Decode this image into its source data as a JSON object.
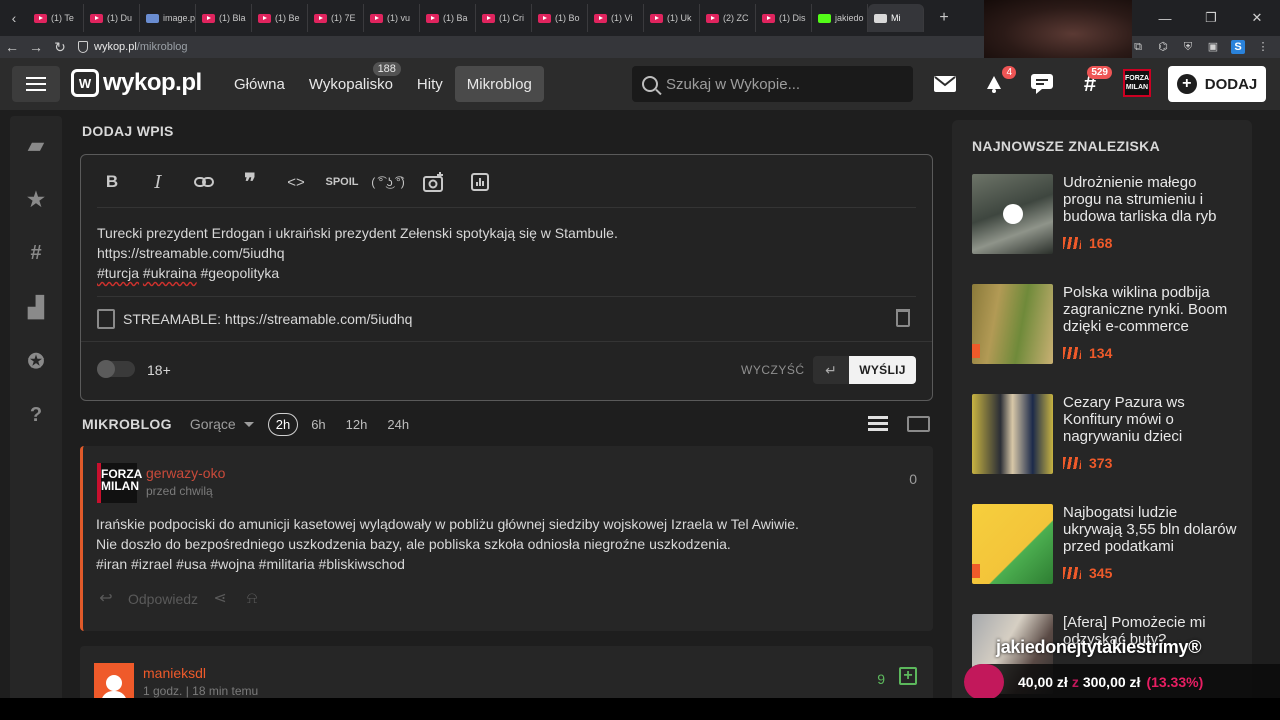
{
  "browser": {
    "tabs": [
      {
        "label": "(1) Te",
        "fav": "youtube"
      },
      {
        "label": "(1) Du",
        "fav": "youtube"
      },
      {
        "label": "image.png",
        "fav": "image"
      },
      {
        "label": "(1) Bla",
        "fav": "youtube"
      },
      {
        "label": "(1) Be",
        "fav": "youtube"
      },
      {
        "label": "(1) 7E",
        "fav": "youtube"
      },
      {
        "label": "(1) vu",
        "fav": "youtube"
      },
      {
        "label": "(1) Ba",
        "fav": "youtube"
      },
      {
        "label": "(1) Cri",
        "fav": "youtube"
      },
      {
        "label": "(1) Bo",
        "fav": "youtube"
      },
      {
        "label": "(1) Vi",
        "fav": "youtube"
      },
      {
        "label": "(1) Uk",
        "fav": "youtube"
      },
      {
        "label": "(2) ZC",
        "fav": "youtube"
      },
      {
        "label": "(1) Dis",
        "fav": "youtube"
      },
      {
        "label": "jakiedo",
        "fav": "kick"
      },
      {
        "label": "Mi",
        "fav": "wykop",
        "active": true
      }
    ],
    "url_host": "wykop.pl",
    "url_path": "/mikroblog"
  },
  "nav": {
    "logo": "wykop.pl",
    "links": [
      {
        "label": "Główna"
      },
      {
        "label": "Wykopalisko",
        "badge": "188"
      },
      {
        "label": "Hity"
      },
      {
        "label": "Mikroblog",
        "active": true
      }
    ],
    "search_placeholder": "Szukaj w Wykopie...",
    "notifications_count": "4",
    "tags_count": "529",
    "avatar_text": "FORZA MILAN",
    "add_label": "DODAJ"
  },
  "compose": {
    "title": "DODAJ WPIS",
    "toolbar": [
      "B",
      "I",
      "link",
      "quote",
      "code",
      "SPOIL",
      "( ͡° ͜ʖ ͡°)",
      "photo",
      "poll"
    ],
    "lines": [
      "Turecki prezydent Erdogan i ukraiński prezydent Zełenski spotykają się w Stambule.",
      "https://streamable.com/5iudhq"
    ],
    "tags_line": {
      "t1": "#turcja",
      "t2": "#ukraina",
      "t3": "#geopolityka"
    },
    "embed_label": "STREAMABLE: https://streamable.com/5iudhq",
    "adult_label": "18+",
    "clear_label": "WYCZYŚĆ",
    "send_label": "WYŚLIJ"
  },
  "feed": {
    "title": "MIKROBLOG",
    "sort": "Gorące",
    "periods": [
      "2h",
      "6h",
      "12h",
      "24h"
    ],
    "active_period": "2h"
  },
  "posts": [
    {
      "author": "gerwazy-oko",
      "time": "przed chwilą",
      "score": "0",
      "avatar_lines": [
        "FORZA",
        "MILAN"
      ],
      "lines": [
        "Irańskie podpociski do amunicji kasetowej wylądowały w pobliżu głównej siedziby wojskowej Izraela w Tel Awiwie.",
        "Nie doszło do bezpośredniego uszkodzenia bazy, ale pobliska szkoła odniosła niegroźne uszkodzenia.",
        "#iran #izrael #usa #wojna #militaria #bliskiwschod"
      ],
      "reply_label": "Odpowiedz"
    },
    {
      "author": "manieksdl",
      "time": "1 godz. | 18 min temu",
      "score": "9"
    }
  ],
  "sidebar_links": {
    "title": "NAJNOWSZE ZNALEZISKA",
    "items": [
      {
        "title": "Udrożnienie małego progu na strumieniu i budowa tarliska dla ryb",
        "votes": "168"
      },
      {
        "title": "Polska wiklina podbija zagraniczne rynki. Boom dzięki e-commerce",
        "votes": "134"
      },
      {
        "title": "Cezary Pazura ws Konfitury mówi o nagrywaniu dzieci",
        "votes": "373"
      },
      {
        "title": "Najbogatsi ludzie ukrywają 3,55 bln dolarów przed podatkami",
        "votes": "345"
      },
      {
        "title": "[Afera] Pomożecie mi odzyskać buty?",
        "votes": ""
      }
    ]
  },
  "overlay": {
    "brand": "jakiedonejtytakiestrimy®",
    "donation_current": "40,00 zł",
    "donation_sep": "z",
    "donation_goal": "300,00 zł",
    "donation_pct": "(13.33%)"
  },
  "colors": {
    "accent": "#ef5a2a",
    "page_bg": "#1e1e1e",
    "panel_bg": "#262626",
    "plus_green": "#5cb85c"
  }
}
